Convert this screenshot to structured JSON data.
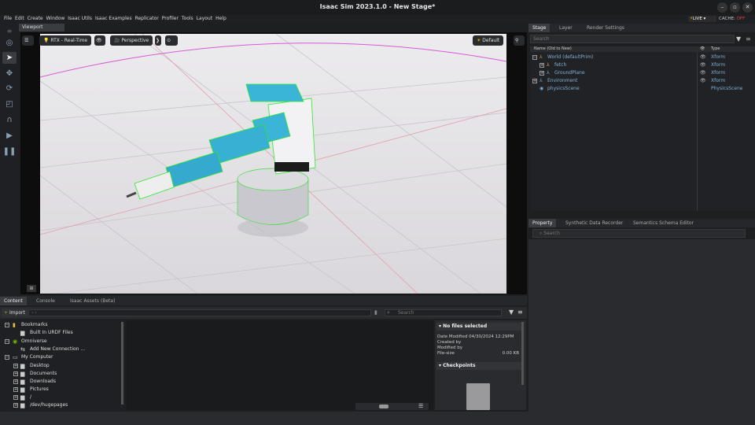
{
  "window": {
    "title": "Isaac Sim 2023.1.0 - New Stage*",
    "minimize": "–",
    "restore": "▫",
    "close": "✕"
  },
  "menu": [
    "File",
    "Edit",
    "Create",
    "Window",
    "Isaac Utils",
    "Isaac Examples",
    "Replicator",
    "Profiler",
    "Tools",
    "Layout",
    "Help"
  ],
  "status": {
    "live": "LIVE",
    "cache_label": "CACHE:",
    "cache_value": "OFF"
  },
  "viewport": {
    "tab": "Viewport",
    "renderer": "RTX - Real-Time",
    "camera": "Perspective",
    "lighting": "Default",
    "corner_badge": "⊞"
  },
  "stage": {
    "tabs": [
      "Stage",
      "Layer",
      "Render Settings"
    ],
    "search_placeholder": "Search",
    "col_name": "Name (Old to New)",
    "col_type": "Type",
    "rows": [
      {
        "name": "World (defaultPrim)",
        "type": "Xform",
        "expander": "−"
      },
      {
        "name": "fetch",
        "type": "Xform",
        "expander": "+"
      },
      {
        "name": "GroundPlane",
        "type": "Xform",
        "expander": "+"
      },
      {
        "name": "Environment",
        "type": "Xform",
        "expander": "+"
      },
      {
        "name": "physicsScene",
        "type": "PhysicsScene",
        "expander": ""
      }
    ]
  },
  "property": {
    "tabs": [
      "Property",
      "Synthetic Data Recorder",
      "Semantics Schema Editor"
    ],
    "search_placeholder": "Search"
  },
  "content": {
    "tabs": [
      "Content",
      "Console",
      "Isaac Assets (Beta)"
    ],
    "import_label": "Import",
    "search_placeholder": "Search",
    "tree": [
      {
        "label": "Bookmarks",
        "indent": 0,
        "expander": "−"
      },
      {
        "label": "Built In URDF Files",
        "indent": 1,
        "expander": ""
      },
      {
        "label": "Omniverse",
        "indent": 0,
        "expander": "−"
      },
      {
        "label": "Add New Connection ...",
        "indent": 1,
        "expander": ""
      },
      {
        "label": "My Computer",
        "indent": 0,
        "expander": "−"
      },
      {
        "label": "Desktop",
        "indent": 1,
        "expander": "+"
      },
      {
        "label": "Documents",
        "indent": 1,
        "expander": "+"
      },
      {
        "label": "Downloads",
        "indent": 1,
        "expander": "+"
      },
      {
        "label": "Pictures",
        "indent": 1,
        "expander": "+"
      },
      {
        "label": "/",
        "indent": 1,
        "expander": "+"
      },
      {
        "label": "/dev/hugepages",
        "indent": 1,
        "expander": "+"
      }
    ],
    "details": {
      "header": "No files selected",
      "date_modified_label": "Date Modified",
      "date_modified": "04/30/2024 12:29PM",
      "created_by": "Created by",
      "modified_by": "Modified by",
      "file_size_label": "File-size",
      "file_size": "0.00 KB",
      "checkpoints": "Checkpoints"
    }
  },
  "colors": {
    "accent": "#76b900",
    "selection_green": "#2fe62f",
    "link_blue": "#7fb0d8"
  }
}
